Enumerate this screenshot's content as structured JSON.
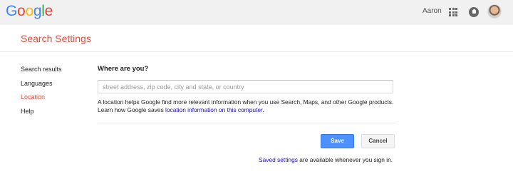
{
  "header": {
    "logo_letters": [
      {
        "char": "G",
        "color": "#4285f4"
      },
      {
        "char": "o",
        "color": "#ea4335"
      },
      {
        "char": "o",
        "color": "#fbbc05"
      },
      {
        "char": "g",
        "color": "#4285f4"
      },
      {
        "char": "l",
        "color": "#34a853"
      },
      {
        "char": "e",
        "color": "#ea4335"
      }
    ],
    "user_name": "Aaron",
    "apps_icon": "apps-grid-icon",
    "notifications_icon": "bell-icon",
    "avatar_icon": "avatar"
  },
  "page": {
    "title": "Search Settings",
    "title_color": "#dd4b39"
  },
  "sidebar": {
    "items": [
      {
        "label": "Search results",
        "active": false
      },
      {
        "label": "Languages",
        "active": false
      },
      {
        "label": "Location",
        "active": true
      },
      {
        "label": "Help",
        "active": false
      }
    ]
  },
  "location": {
    "section_title": "Where are you?",
    "input_value": "",
    "input_placeholder": "street address, zip code, city and state, or country",
    "help_text": "A location helps Google find more relevant information when you use Search, Maps, and other Google products. Learn how Google saves ",
    "help_link": "location information on this computer",
    "help_text_end": "."
  },
  "actions": {
    "save_label": "Save",
    "cancel_label": "Cancel",
    "save_color": "#4d90fe"
  },
  "footer": {
    "link": "Saved settings",
    "text": " are available whenever you sign in.",
    "link_color": "#1a0dab"
  }
}
